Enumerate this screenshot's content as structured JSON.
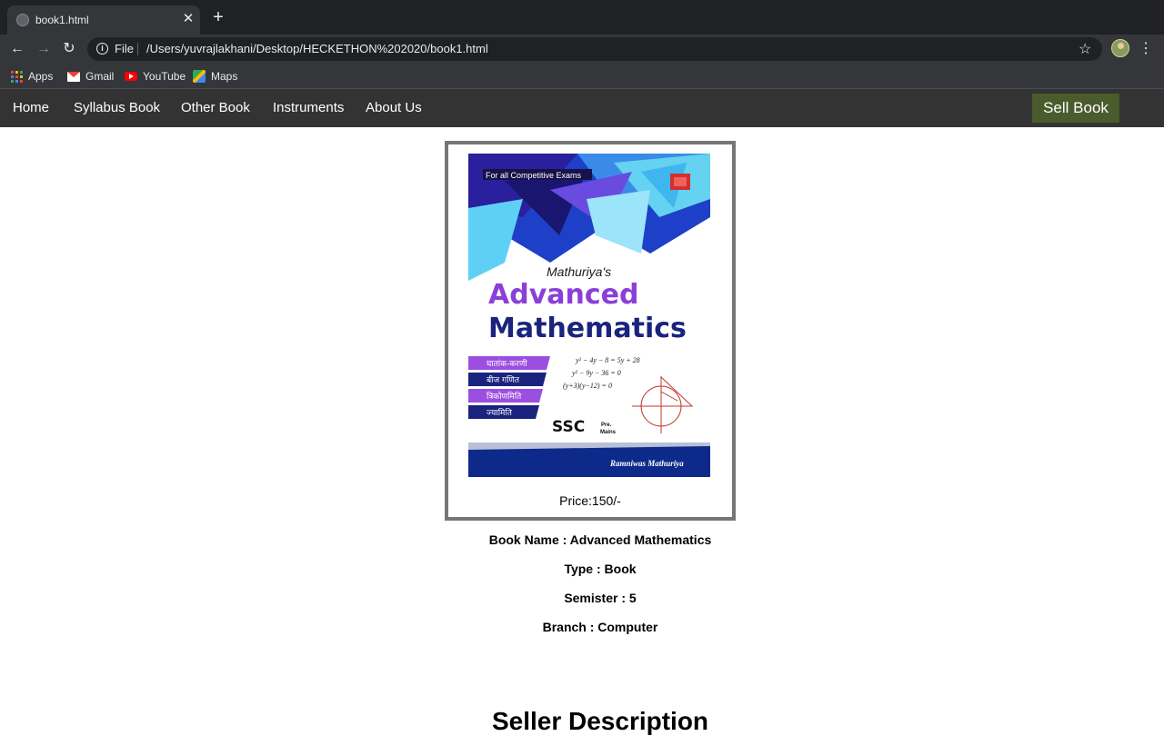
{
  "browser": {
    "tab_title": "book1.html",
    "scheme_label": "File",
    "url": "/Users/yuvrajlakhani/Desktop/HECKETHON%202020/book1.html",
    "bookmarks": [
      {
        "label": "Apps",
        "icon": "apps-icon"
      },
      {
        "label": "Gmail",
        "icon": "gmail-icon"
      },
      {
        "label": "YouTube",
        "icon": "youtube-icon"
      },
      {
        "label": "Maps",
        "icon": "maps-icon"
      }
    ]
  },
  "nav": {
    "links": [
      "Home",
      "Syllabus Book",
      "Other Book",
      "Instruments",
      "About Us"
    ],
    "sell_label": "Sell Book"
  },
  "book": {
    "cover": {
      "tagline": "For all Competitive Exams",
      "author_italic": "Mathuriya's",
      "title_line1": "Advanced",
      "title_line2": "Mathematics",
      "topics": [
        "घातांक-करणी",
        "बीज गणित",
        "त्रिकोणमिति",
        "ज्यामिति"
      ],
      "equations": [
        "y² − 4y − 8 = 5y + 28",
        "y² − 9y − 36 = 0",
        "(y+3)(y−12) = 0"
      ],
      "exam_label": "SSC",
      "exam_sub_top": "Pre.",
      "exam_sub_bottom": "Mains",
      "author_footer": "Ramniwas Mathuriya"
    },
    "price": "Price:150/-",
    "details": [
      "Book Name : Advanced Mathematics",
      "Type : Book",
      "Semister : 5",
      "Branch : Computer"
    ]
  },
  "seller": {
    "heading": "Seller Description"
  },
  "colors": {
    "nav_bg": "#333333",
    "sell_button": "#4a5b2c",
    "title_purple": "#8b3fd9",
    "title_navy": "#1a237e"
  }
}
